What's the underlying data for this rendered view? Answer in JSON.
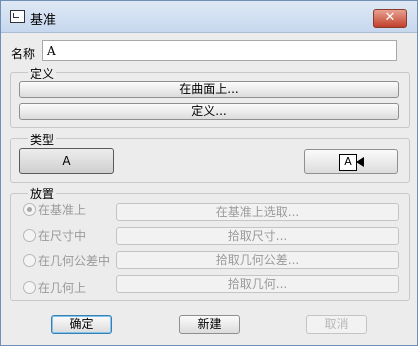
{
  "window": {
    "title": "基准",
    "close_glyph": "✕"
  },
  "name": {
    "label": "名称",
    "value": "A"
  },
  "definition": {
    "group_label": "定义",
    "on_surface_label": "在曲面上...",
    "define_label": "定义..."
  },
  "type": {
    "group_label": "类型",
    "type_a_label": "A",
    "type_arrow_label": "A"
  },
  "placement": {
    "group_label": "放置",
    "options": [
      {
        "label": "在基准上",
        "button": "在基准上选取..."
      },
      {
        "label": "在尺寸中",
        "button": "拾取尺寸..."
      },
      {
        "label": "在几何公差中",
        "button": "拾取几何公差..."
      },
      {
        "label": "在几何上",
        "button": "拾取几何..."
      }
    ],
    "selected_index": 0
  },
  "footer": {
    "ok_label": "确定",
    "new_label": "新建",
    "cancel_label": "取消"
  }
}
